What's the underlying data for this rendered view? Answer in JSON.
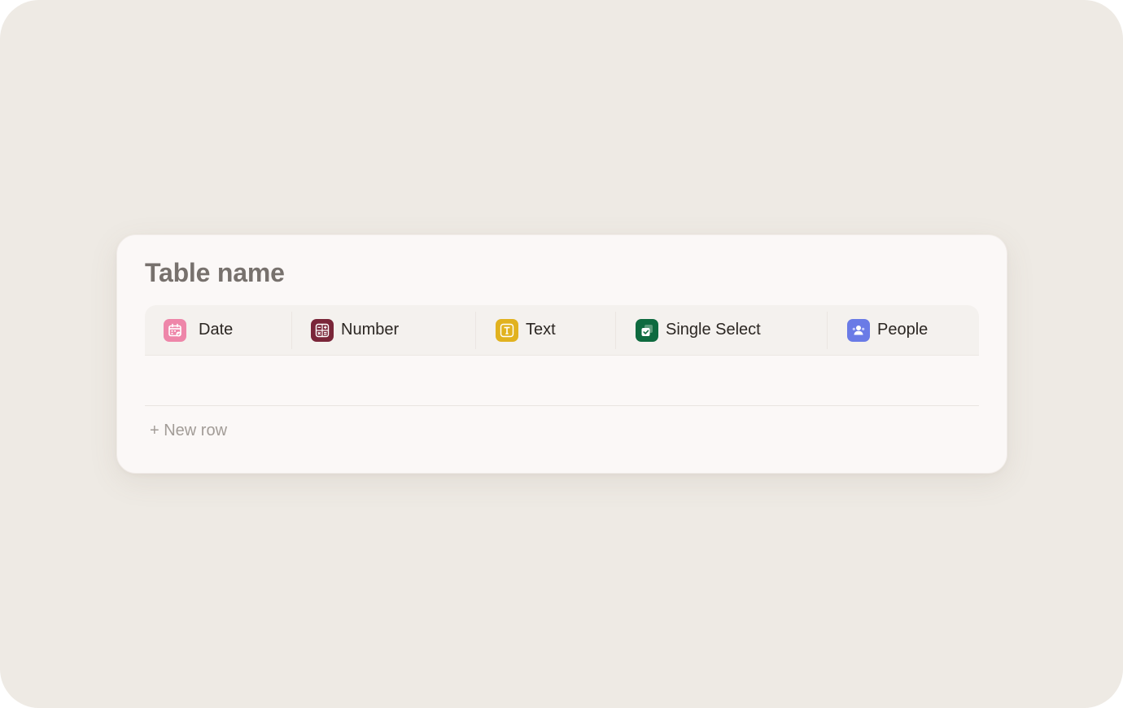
{
  "table": {
    "title": "Table name",
    "new_row_label": "+ New row",
    "columns": [
      {
        "label": "Date",
        "icon": "calendar-icon",
        "color": "#ee86a9"
      },
      {
        "label": "Number",
        "icon": "calculator-icon",
        "color": "#7a2639"
      },
      {
        "label": "Text",
        "icon": "text-icon",
        "color": "#e1b21f"
      },
      {
        "label": "Single Select",
        "icon": "select-check-icon",
        "color": "#0e6a3f"
      },
      {
        "label": "People",
        "icon": "people-icon",
        "color": "#6a7be6"
      }
    ]
  }
}
